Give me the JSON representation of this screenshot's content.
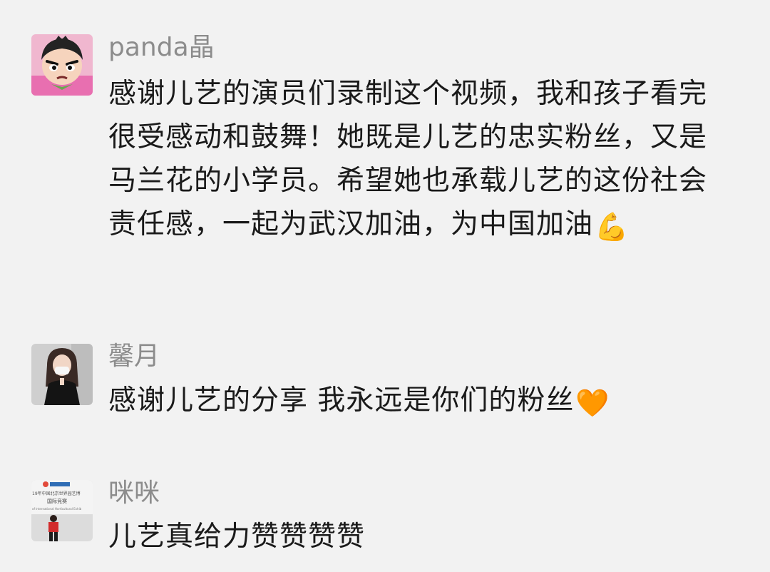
{
  "comments": [
    {
      "author": "panda晶",
      "text": "感谢儿艺的演员们录制这个视频，我和孩子看完很受感动和鼓舞！她既是儿艺的忠实粉丝，又是马兰花的小学员。希望她也承载儿艺的这份社会责任感，一起为武汉加油，为中国加油",
      "emoji": "💪",
      "emoji_name": "flexed-biceps-emoji",
      "avatar": "cartoon-boy-avatar"
    },
    {
      "author": "馨月",
      "text": "感谢儿艺的分享 我永远是你们的粉丝",
      "emoji": "🧡",
      "emoji_name": "orange-heart-emoji",
      "avatar": "woman-photo-avatar"
    },
    {
      "author": "咪咪",
      "text": "儿艺真给力赞赞赞赞",
      "avatar": "expo-photo-avatar",
      "avatar_sign_text": {
        "line1": "19年中国北京世界园艺博",
        "line2": "国际竞赛",
        "line3": "of International Horticultural Exhib"
      }
    }
  ]
}
